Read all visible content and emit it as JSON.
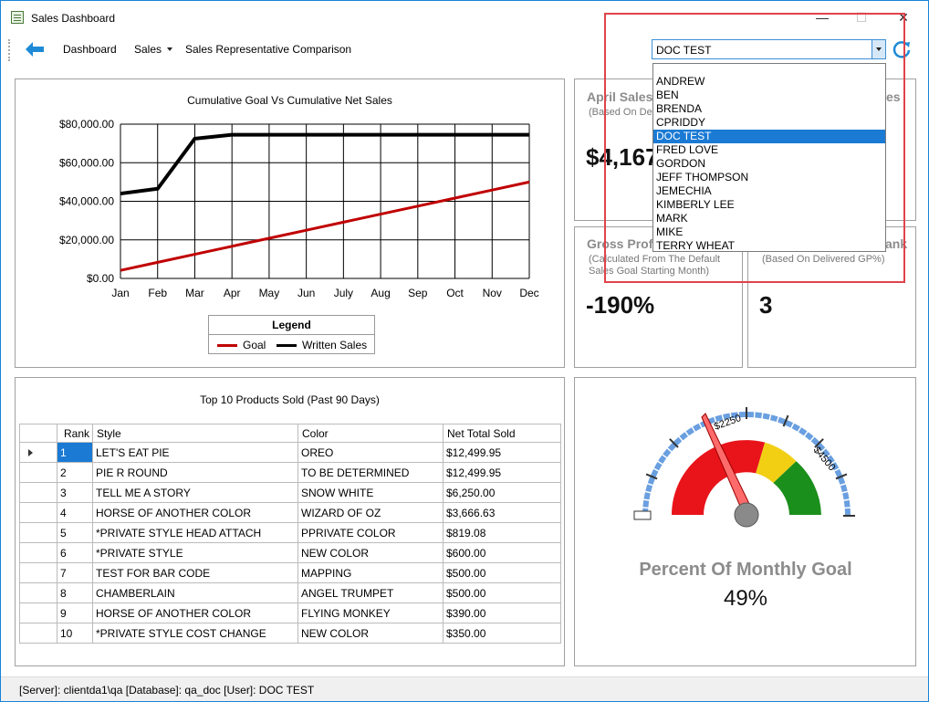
{
  "window": {
    "title": "Sales Dashboard",
    "controls": {
      "minimize": "—",
      "maximize": "☐",
      "close": "✕"
    }
  },
  "toolbar": {
    "back_icon": "back-arrow-icon",
    "dashboard_label": "Dashboard",
    "sales_label": "Sales",
    "comparison_label": "Sales Representative Comparison",
    "selected_rep": "DOC TEST",
    "refresh_icon": "refresh-icon"
  },
  "dropdown": {
    "items": [
      "ANDREW",
      "BEN",
      "BRENDA",
      "CPRIDDY",
      "DOC TEST",
      "FRED LOVE",
      "GORDON",
      "JEFF THOMPSON",
      "JEMECHIA",
      "KIMBERLY LEE",
      "MARK",
      "MIKE",
      "TERRY WHEAT"
    ],
    "selected_index": 4
  },
  "line_chart": {
    "title": "Cumulative Goal Vs Cumulative Net Sales",
    "legend_title": "Legend",
    "y_tick_labels": [
      "$80,000.00",
      "$60,000.00",
      "$40,000.00",
      "$20,000.00",
      "$0.00"
    ],
    "x_tick_labels": [
      "Jan",
      "Feb",
      "Mar",
      "Apr",
      "May",
      "Jun",
      "July",
      "Aug",
      "Sep",
      "Oct",
      "Nov",
      "Dec"
    ]
  },
  "kpis": {
    "april": {
      "title": "April Sales",
      "sub": "(Based On Default",
      "value": "$4,167"
    },
    "top_right": {
      "title": "es"
    },
    "gross": {
      "title": "Gross Profit",
      "sub1": "(Calculated From The Default",
      "sub2": "Sales Goal Starting Month)",
      "value": "-190%"
    },
    "rank": {
      "title": "ank",
      "sub": "(Based On Delivered GP%)",
      "value": "3"
    }
  },
  "products": {
    "title": "Top 10 Products Sold (Past 90 Days)",
    "columns": [
      "Rank",
      "Style",
      "Color",
      "Net Total Sold"
    ],
    "rows": [
      [
        "1",
        "LET'S EAT PIE",
        "OREO",
        "$12,499.95"
      ],
      [
        "2",
        "PIE R ROUND",
        "TO BE DETERMINED",
        "$12,499.95"
      ],
      [
        "3",
        "TELL ME A STORY",
        "SNOW WHITE",
        "$6,250.00"
      ],
      [
        "4",
        "HORSE OF ANOTHER COLOR",
        "WIZARD OF OZ",
        "$3,666.63"
      ],
      [
        "5",
        "*PRIVATE STYLE  HEAD ATTACH",
        "PPRIVATE COLOR",
        "$819.08"
      ],
      [
        "6",
        "*PRIVATE STYLE",
        "NEW COLOR",
        "$600.00"
      ],
      [
        "7",
        "TEST FOR BAR CODE",
        "MAPPING",
        "$500.00"
      ],
      [
        "8",
        "CHAMBERLAIN",
        "ANGEL TRUMPET",
        "$500.00"
      ],
      [
        "9",
        "HORSE OF ANOTHER COLOR",
        "FLYING MONKEY",
        "$390.00"
      ],
      [
        "10",
        "*PRIVATE STYLE COST CHANGE",
        "NEW COLOR",
        "$350.00"
      ]
    ]
  },
  "gauge": {
    "title": "Percent Of Monthly Goal",
    "value_text": "49%",
    "tick_labels": [
      "$2250",
      "$4500"
    ],
    "colors": {
      "red": "#e8141a",
      "yellow": "#f2cf13",
      "green": "#1b8f1b",
      "ring": "#6a9fe0"
    }
  },
  "status": {
    "text": "[Server]: clientda1\\qa  [Database]: qa_doc  [User]: DOC TEST"
  },
  "chart_data": {
    "type": "line",
    "title": "Cumulative Goal Vs Cumulative Net Sales",
    "xlabel": "",
    "ylabel": "",
    "categories": [
      "Jan",
      "Feb",
      "Mar",
      "Apr",
      "May",
      "Jun",
      "July",
      "Aug",
      "Sep",
      "Oct",
      "Nov",
      "Dec"
    ],
    "ylim": [
      0,
      80000
    ],
    "series": [
      {
        "name": "Goal",
        "color": "#c00000",
        "values": [
          4167,
          8333,
          12500,
          16667,
          20833,
          25000,
          29167,
          33333,
          37500,
          41667,
          45833,
          50000
        ]
      },
      {
        "name": "Written Sales",
        "color": "#000000",
        "values": [
          44000,
          46500,
          72500,
          74500,
          74500,
          74500,
          74500,
          74500,
          74500,
          74500,
          74500,
          74500
        ]
      }
    ],
    "legend_position": "bottom",
    "grid": true
  }
}
